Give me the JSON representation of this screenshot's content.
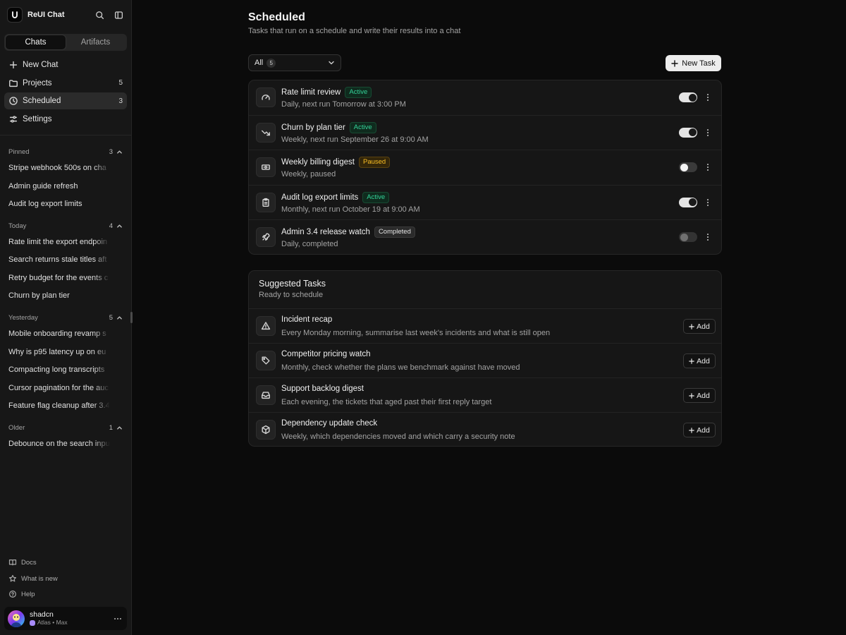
{
  "app": {
    "title": "ReUI Chat"
  },
  "sidebar": {
    "tabs": [
      {
        "label": "Chats",
        "active": true
      },
      {
        "label": "Artifacts",
        "active": false
      }
    ],
    "nav": [
      {
        "label": "New Chat",
        "icon": "plus-icon",
        "count": ""
      },
      {
        "label": "Projects",
        "icon": "folder-icon",
        "count": "5"
      },
      {
        "label": "Scheduled",
        "icon": "clock-icon",
        "count": "3",
        "active": true
      },
      {
        "label": "Settings",
        "icon": "sliders-icon",
        "count": ""
      }
    ],
    "groups": [
      {
        "label": "Pinned",
        "count": "3",
        "items": [
          "Stripe webhook 500s on cha",
          "Admin guide refresh",
          "Audit log export limits"
        ]
      },
      {
        "label": "Today",
        "count": "4",
        "items": [
          "Rate limit the export endpoin",
          "Search returns stale titles aft",
          "Retry budget for the events c",
          "Churn by plan tier"
        ]
      },
      {
        "label": "Yesterday",
        "count": "5",
        "items": [
          "Mobile onboarding revamp s",
          "Why is p95 latency up on eu",
          "Compacting long transcripts",
          "Cursor pagination for the auc",
          "Feature flag cleanup after 3.4"
        ]
      },
      {
        "label": "Older",
        "count": "1",
        "items": [
          "Debounce on the search inpu"
        ]
      }
    ],
    "footer": [
      {
        "label": "Docs",
        "icon": "book-icon"
      },
      {
        "label": "What is new",
        "icon": "star-icon"
      },
      {
        "label": "Help",
        "icon": "help-icon"
      }
    ],
    "user": {
      "name": "shadcn",
      "plan": "Atlas • Max"
    }
  },
  "main": {
    "title": "Scheduled",
    "subtitle": "Tasks that run on a schedule and write their results into a chat",
    "filter": {
      "label": "All",
      "count": "5"
    },
    "new_task_label": "New Task",
    "tasks": [
      {
        "title": "Rate limit review",
        "status": "Active",
        "status_kind": "active",
        "schedule": "Daily, next run Tomorrow at 3:00 PM",
        "icon": "gauge-icon",
        "enabled": true
      },
      {
        "title": "Churn by plan tier",
        "status": "Active",
        "status_kind": "active",
        "schedule": "Weekly, next run September 26 at 9:00 AM",
        "icon": "trending-down-icon",
        "enabled": true
      },
      {
        "title": "Weekly billing digest",
        "status": "Paused",
        "status_kind": "paused",
        "schedule": "Weekly, paused",
        "icon": "banknote-icon",
        "enabled": false
      },
      {
        "title": "Audit log export limits",
        "status": "Active",
        "status_kind": "active",
        "schedule": "Monthly, next run October 19 at 9:00 AM",
        "icon": "clipboard-icon",
        "enabled": true
      },
      {
        "title": "Admin 3.4 release watch",
        "status": "Completed",
        "status_kind": "completed",
        "schedule": "Daily, completed",
        "icon": "rocket-icon",
        "enabled": false,
        "disabled": true
      }
    ],
    "suggested": {
      "title": "Suggested Tasks",
      "subtitle": "Ready to schedule",
      "add_label": "Add",
      "items": [
        {
          "title": "Incident recap",
          "description": "Every Monday morning, summarise last week's incidents and what is still open",
          "icon": "alert-triangle-icon"
        },
        {
          "title": "Competitor pricing watch",
          "description": "Monthly, check whether the plans we benchmark against have moved",
          "icon": "tag-icon"
        },
        {
          "title": "Support backlog digest",
          "description": "Each evening, the tickets that aged past their first reply target",
          "icon": "inbox-icon"
        },
        {
          "title": "Dependency update check",
          "description": "Weekly, which dependencies moved and which carry a security note",
          "icon": "package-icon"
        }
      ]
    }
  },
  "colors": {
    "accent_active": "#34d399",
    "accent_paused": "#fbbf24",
    "background": "#0b0b0b",
    "sidebar": "#171717"
  }
}
